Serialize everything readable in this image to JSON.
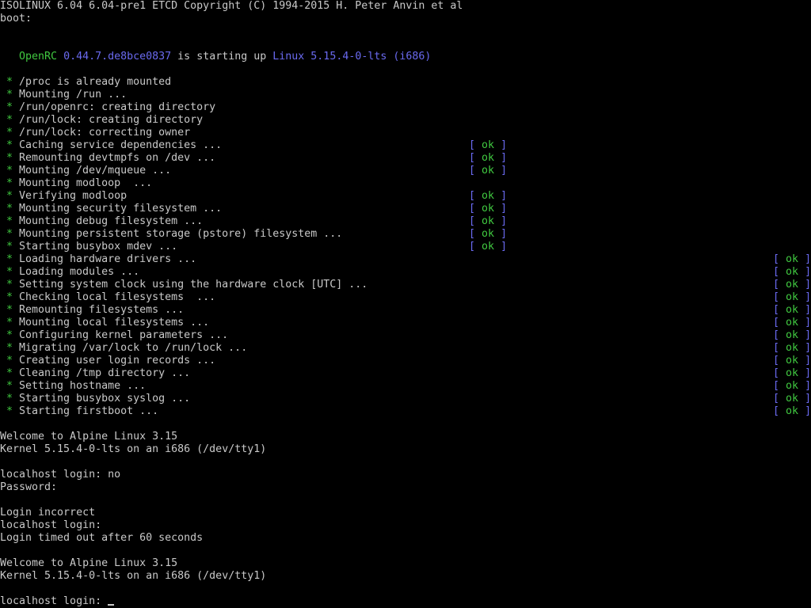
{
  "header": {
    "isolinux": "ISOLINUX 6.04 6.04-pre1 ETCD Copyright (C) 1994-2015 H. Peter Anvin et al",
    "boot_prompt": "boot:"
  },
  "openrc": {
    "name": "OpenRC",
    "version": "0.44.7.de8bce0837",
    "status_text": "is starting up",
    "kernel": "Linux 5.15.4-0-lts (i686)"
  },
  "boot_messages": [
    {
      "star": "*",
      "text": "/proc is already mounted",
      "status": ""
    },
    {
      "star": "*",
      "text": "Mounting /run ...",
      "status": ""
    },
    {
      "star": "*",
      "text": "/run/openrc: creating directory",
      "status": ""
    },
    {
      "star": "*",
      "text": "/run/lock: creating directory",
      "status": ""
    },
    {
      "star": "*",
      "text": "/run/lock: correcting owner",
      "status": ""
    },
    {
      "star": "*",
      "text": "Caching service dependencies ...",
      "status": "ok"
    },
    {
      "star": "*",
      "text": "Remounting devtmpfs on /dev ...",
      "status": "ok"
    },
    {
      "star": "*",
      "text": "Mounting /dev/mqueue ...",
      "status": "ok"
    },
    {
      "star": "*",
      "text": "Mounting modloop  ...",
      "status": ""
    },
    {
      "star": "*",
      "text": "Verifying modloop",
      "status": "ok"
    },
    {
      "star": "*",
      "text": "Mounting security filesystem ...",
      "status": "ok"
    },
    {
      "star": "*",
      "text": "Mounting debug filesystem ...",
      "status": "ok"
    },
    {
      "star": "*",
      "text": "Mounting persistent storage (pstore) filesystem ...",
      "status": "ok"
    },
    {
      "star": "*",
      "text": "Starting busybox mdev ...",
      "status": "ok"
    },
    {
      "star": "*",
      "text": "Loading hardware drivers ...",
      "status": "ok"
    },
    {
      "star": "*",
      "text": "Loading modules ...",
      "status": "ok"
    },
    {
      "star": "*",
      "text": "Setting system clock using the hardware clock [UTC] ...",
      "status": "ok"
    },
    {
      "star": "*",
      "text": "Checking local filesystems  ...",
      "status": "ok"
    },
    {
      "star": "*",
      "text": "Remounting filesystems ...",
      "status": "ok"
    },
    {
      "star": "*",
      "text": "Mounting local filesystems ...",
      "status": "ok"
    },
    {
      "star": "*",
      "text": "Configuring kernel parameters ...",
      "status": "ok"
    },
    {
      "star": "*",
      "text": "Migrating /var/lock to /run/lock ...",
      "status": "ok"
    },
    {
      "star": "*",
      "text": "Creating user login records ...",
      "status": "ok"
    },
    {
      "star": "*",
      "text": "Cleaning /tmp directory ...",
      "status": "ok"
    },
    {
      "star": "*",
      "text": "Setting hostname ...",
      "status": "ok"
    },
    {
      "star": "*",
      "text": "Starting busybox syslog ...",
      "status": "ok"
    },
    {
      "star": "*",
      "text": "Starting firstboot ...",
      "status": "ok"
    }
  ],
  "status_brackets": {
    "open": "[",
    "close": "]"
  },
  "session": {
    "welcome_1": "Welcome to Alpine Linux 3.15",
    "kernel_1": "Kernel 5.15.4-0-lts on an i686 (/dev/tty1)",
    "login_1": "localhost login: no",
    "password": "Password:",
    "login_incorrect": "Login incorrect",
    "login_2": "localhost login:",
    "timeout": "Login timed out after 60 seconds",
    "welcome_2": "Welcome to Alpine Linux 3.15",
    "kernel_2": "Kernel 5.15.4-0-lts on an i686 (/dev/tty1)",
    "login_prompt": "localhost login:",
    "login_input": ""
  },
  "colors": {
    "background": "#000000",
    "text": "#c9c9c9",
    "ok_green": "#40c840",
    "bracket_blue": "#6a6af0",
    "star_green": "#40c840"
  }
}
